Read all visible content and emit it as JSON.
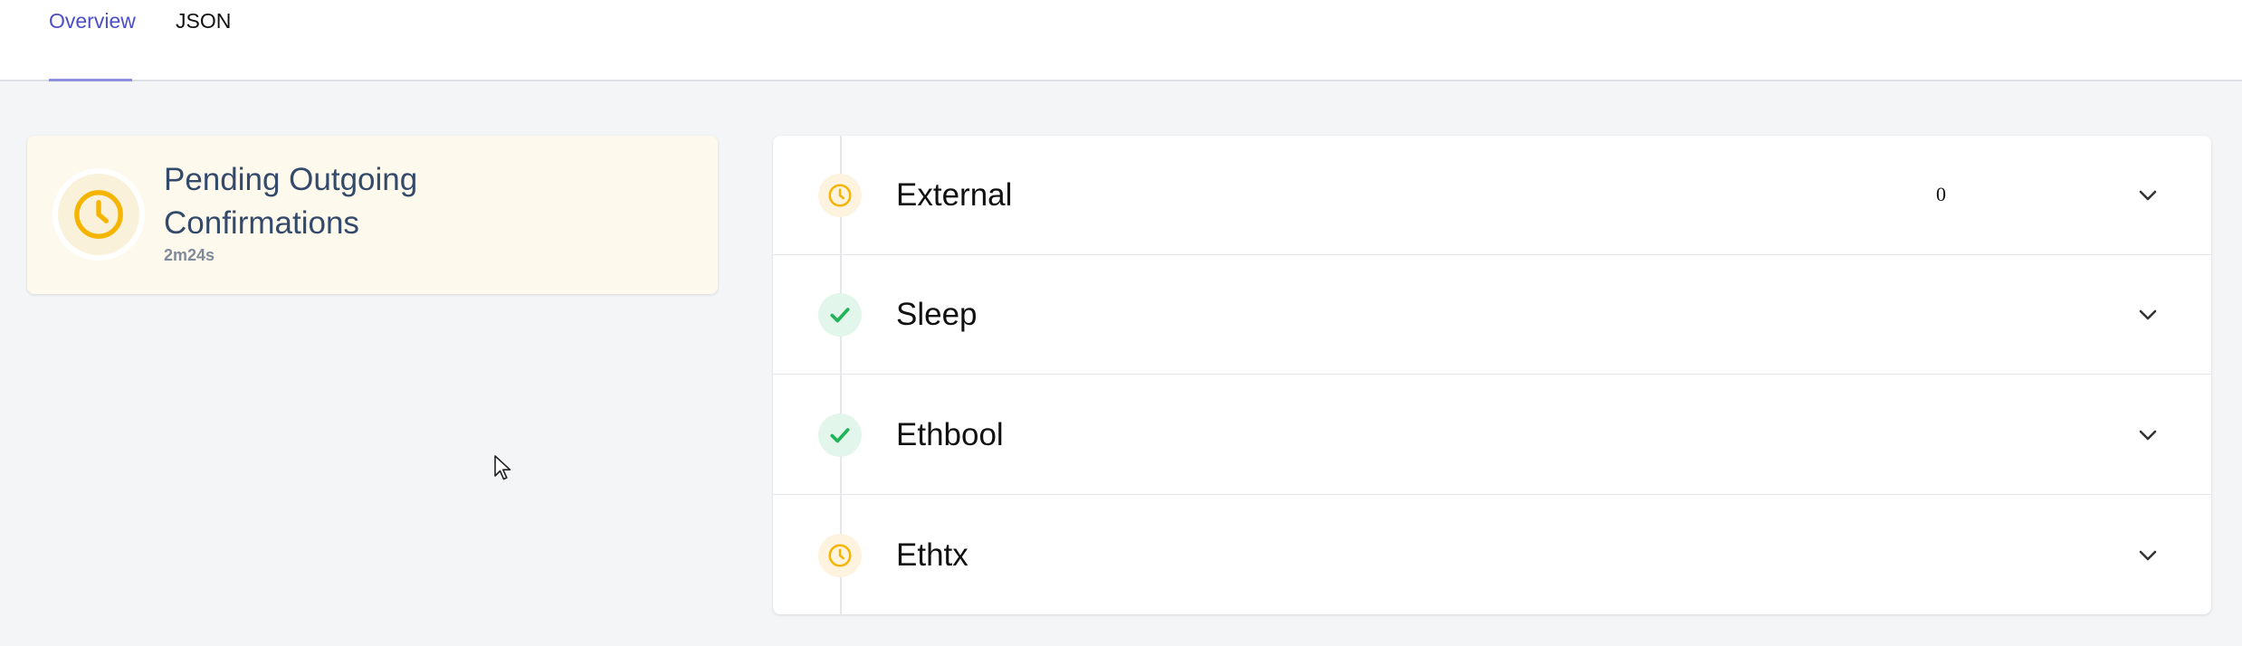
{
  "tabs": {
    "overview": "Overview",
    "json": "JSON"
  },
  "status": {
    "title": "Pending Outgoing Confirmations",
    "duration": "2m24s",
    "icon": "clock-icon",
    "accent": "#f5b400"
  },
  "steps": [
    {
      "name": "External",
      "state": "pending",
      "icon": "clock-icon",
      "extra": "0"
    },
    {
      "name": "Sleep",
      "state": "done",
      "icon": "check-icon"
    },
    {
      "name": "Ethbool",
      "state": "done",
      "icon": "check-icon"
    },
    {
      "name": "Ethtx",
      "state": "pending",
      "icon": "clock-icon"
    }
  ],
  "colors": {
    "active_tab": "#4c4fc4",
    "pending": "#f5b400",
    "done": "#1fb45a"
  }
}
